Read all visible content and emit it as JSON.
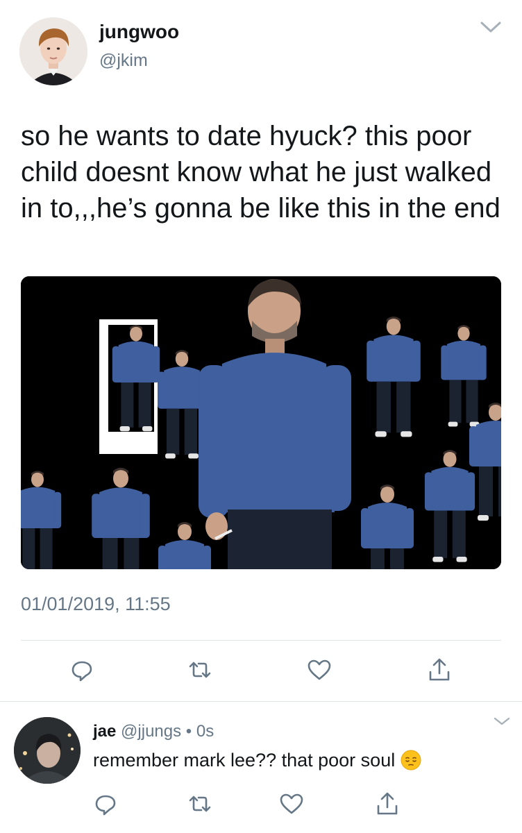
{
  "tweet": {
    "display_name": "jungwoo",
    "handle": "@jkim",
    "text": "so he wants to date hyuck? this poor child doesnt know what he just walked in to,,,he’s gonna be like this in the end",
    "timestamp": "01/01/2019, 11:55",
    "actions": [
      "reply-icon",
      "retweet-icon",
      "like-icon",
      "share-icon"
    ]
  },
  "reply": {
    "display_name": "jae",
    "handle": "@jjungs",
    "separator": "•",
    "time": "0s",
    "text": "remember mark lee?? that poor soul",
    "emoji": "pensive-face-emoji",
    "actions": [
      "reply-icon",
      "retweet-icon",
      "like-icon",
      "share-icon"
    ]
  },
  "colors": {
    "text_primary": "#14171a",
    "text_secondary": "#657786",
    "icon": "#657786",
    "divider": "#dfe3e7",
    "figure_sweater": "#3f5f9e"
  }
}
